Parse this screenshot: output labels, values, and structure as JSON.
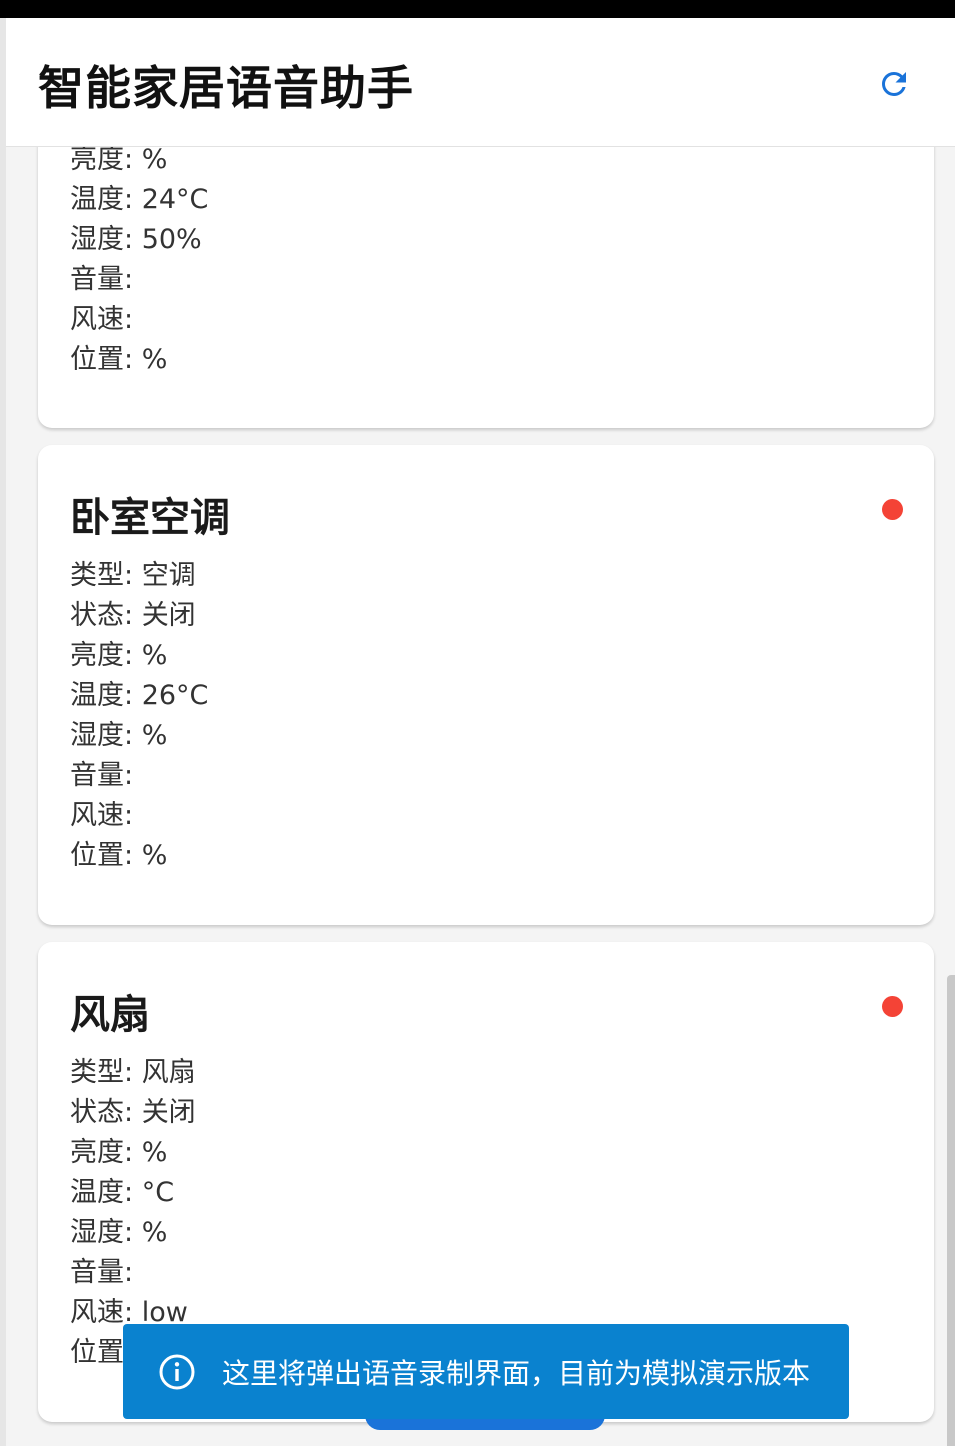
{
  "app": {
    "title": "智能家居语音助手",
    "refresh_icon": "refresh-icon",
    "accent_color": "#1a73d9"
  },
  "devices": [
    {
      "name": "",
      "status_color": "",
      "attributes": [
        {
          "label": "亮度",
          "value": "%"
        },
        {
          "label": "温度",
          "value": "24°C"
        },
        {
          "label": "湿度",
          "value": "50%"
        },
        {
          "label": "音量",
          "value": ""
        },
        {
          "label": "风速",
          "value": ""
        },
        {
          "label": "位置",
          "value": "%"
        }
      ]
    },
    {
      "name": "卧室空调",
      "status_color": "#f44336",
      "attributes": [
        {
          "label": "类型",
          "value": "空调"
        },
        {
          "label": "状态",
          "value": "关闭"
        },
        {
          "label": "亮度",
          "value": "%"
        },
        {
          "label": "温度",
          "value": "26°C"
        },
        {
          "label": "湿度",
          "value": "%"
        },
        {
          "label": "音量",
          "value": ""
        },
        {
          "label": "风速",
          "value": ""
        },
        {
          "label": "位置",
          "value": "%"
        }
      ]
    },
    {
      "name": "风扇",
      "status_color": "#f44336",
      "attributes": [
        {
          "label": "类型",
          "value": "风扇"
        },
        {
          "label": "状态",
          "value": "关闭"
        },
        {
          "label": "亮度",
          "value": "%"
        },
        {
          "label": "温度",
          "value": "°C"
        },
        {
          "label": "湿度",
          "value": "%"
        },
        {
          "label": "音量",
          "value": ""
        },
        {
          "label": "风速",
          "value": "low"
        },
        {
          "label": "位置",
          "value": ""
        }
      ]
    }
  ],
  "toast": {
    "icon": "info-icon",
    "message": "这里将弹出语音录制界面，目前为模拟演示版本",
    "background": "#0a82cf"
  }
}
